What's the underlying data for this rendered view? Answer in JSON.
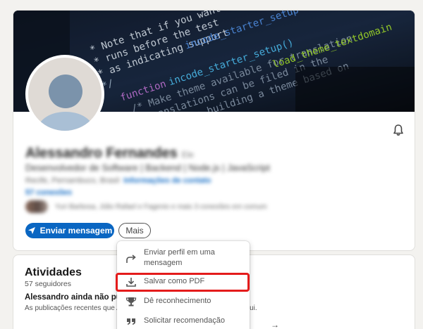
{
  "profile": {
    "name": "Alessandro Fernandes",
    "pronoun": "Ele",
    "headline": "Desenvolvedor de Software | Backend | Node.js | JavaScript",
    "location": "Recife, Pernambuco, Brasil",
    "contact_link": "Informações de contato",
    "connections": "57 conexões",
    "mutual_connections": "Yuri Barbosa, Júlio Rafael e Fagenio e mais 3 conexões em comum",
    "actions": {
      "message_label": "Enviar mensagem",
      "more_label": "Mais"
    }
  },
  "more_menu": {
    "items": [
      {
        "label": "Enviar perfil em uma mensagem",
        "icon": "share-arrow-icon"
      },
      {
        "label": "Salvar como PDF",
        "icon": "download-icon",
        "highlighted": true
      },
      {
        "label": "Dê reconhecimento",
        "icon": "trophy-icon"
      },
      {
        "label": "Solicitar recomendação",
        "icon": "quote-icon"
      }
    ]
  },
  "activity": {
    "title": "Atividades",
    "followers": "57 seguidores",
    "empty_title": "Alessandro ainda não publicou nada",
    "empty_subtitle": "As publicações recentes que Alessandro compartilhar serão exibidas aqui."
  },
  "colors": {
    "primary": "#0a66c2",
    "highlight": "#e41b1b",
    "page_bg": "#f3f2ef"
  }
}
